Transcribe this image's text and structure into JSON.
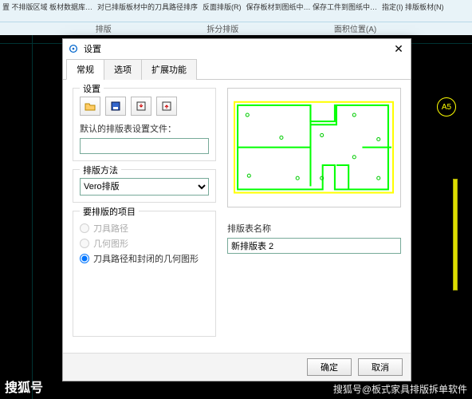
{
  "ribbon": {
    "items": [
      "置 不排版区域 板材数据库…",
      "对已排版板材中的刀具路径排序",
      "反面排版(R)",
      "保存板材到图纸中… 保存工件到图纸中…",
      "指定(I) 排版板材(N)"
    ],
    "row2": [
      "排版",
      "拆分排版",
      "面积位置(A)"
    ]
  },
  "canvas": {
    "badge": "A5"
  },
  "dialog": {
    "title": "设置",
    "tabs": [
      "常规",
      "选项",
      "扩展功能"
    ],
    "active_tab": 0,
    "settings_group": {
      "title": "设置",
      "default_file_label": "默认的排版表设置文件：",
      "default_file_value": ""
    },
    "method_group": {
      "title": "排版方法",
      "selected": "Vero排版"
    },
    "items_group": {
      "title": "要排版的项目",
      "options": [
        "刀具路径",
        "几何图形",
        "刀具路径和封闭的几何图形"
      ],
      "selected_index": 2
    },
    "name_field": {
      "label": "排版表名称",
      "value": "新排版表 2"
    },
    "buttons": {
      "ok": "确定",
      "cancel": "取消"
    }
  },
  "watermark": {
    "left": "搜狐号",
    "right": "搜狐号@板式家具排版拆单软件"
  }
}
